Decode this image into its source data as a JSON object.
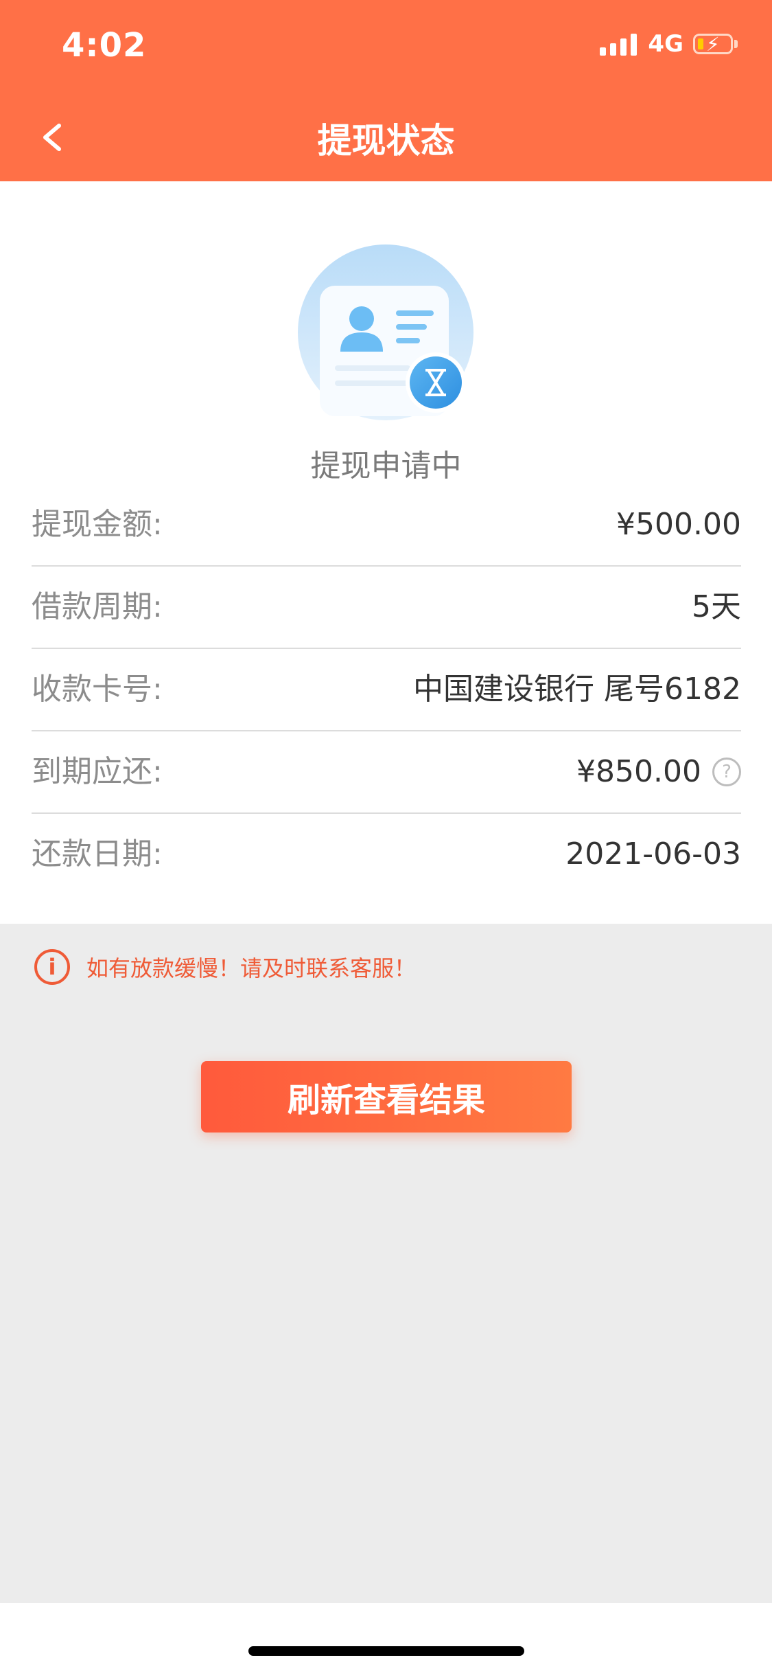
{
  "status_bar": {
    "time": "4:02",
    "network": "4G"
  },
  "header": {
    "title": "提现状态"
  },
  "status": {
    "text": "提现申请中"
  },
  "details": [
    {
      "label": "提现金额:",
      "value": "¥500.00"
    },
    {
      "label": "借款周期:",
      "value": "5天"
    },
    {
      "label": "收款卡号:",
      "value": "中国建设银行 尾号6182"
    },
    {
      "label": "到期应还:",
      "value": "¥850.00"
    },
    {
      "label": "还款日期:",
      "value": "2021-06-03"
    }
  ],
  "notice": {
    "text": "如有放款缓慢！请及时联系客服！"
  },
  "refresh_button": {
    "label": "刷新查看结果"
  },
  "colors": {
    "brand": "#ff7047",
    "warning": "#ef5b37",
    "background": "#ececec"
  },
  "icons": [
    "back-icon",
    "signal-icon",
    "battery-icon",
    "id-card-pending-icon",
    "hourglass-icon",
    "help-icon",
    "info-icon"
  ]
}
